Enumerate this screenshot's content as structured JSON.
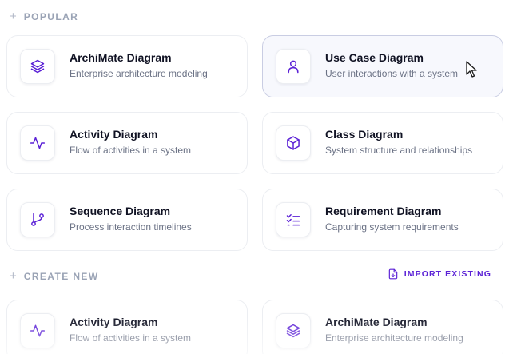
{
  "popular": {
    "label": "POPULAR",
    "cards": [
      {
        "title": "ArchiMate Diagram",
        "description": "Enterprise architecture modeling",
        "icon": "layers-icon"
      },
      {
        "title": "Use Case Diagram",
        "description": "User interactions with a system",
        "icon": "user-icon"
      },
      {
        "title": "Activity Diagram",
        "description": "Flow of activities in a system",
        "icon": "activity-icon"
      },
      {
        "title": "Class Diagram",
        "description": "System structure and relationships",
        "icon": "box-icon"
      },
      {
        "title": "Sequence Diagram",
        "description": "Process interaction timelines",
        "icon": "git-branch-icon"
      },
      {
        "title": "Requirement Diagram",
        "description": "Capturing system requirements",
        "icon": "checklist-icon"
      }
    ]
  },
  "create_new": {
    "label": "CREATE NEW",
    "import_label": "IMPORT EXISTING",
    "cards": [
      {
        "title": "Activity Diagram",
        "description": "Flow of activities in a system",
        "icon": "activity-icon"
      },
      {
        "title": "ArchiMate Diagram",
        "description": "Enterprise architecture modeling",
        "icon": "layers-icon"
      }
    ]
  },
  "colors": {
    "accent": "#5b21d6",
    "section_label": "#9aa3b5",
    "title": "#101223",
    "description": "#6b7285",
    "active_card_bg": "#f7f8fd"
  }
}
